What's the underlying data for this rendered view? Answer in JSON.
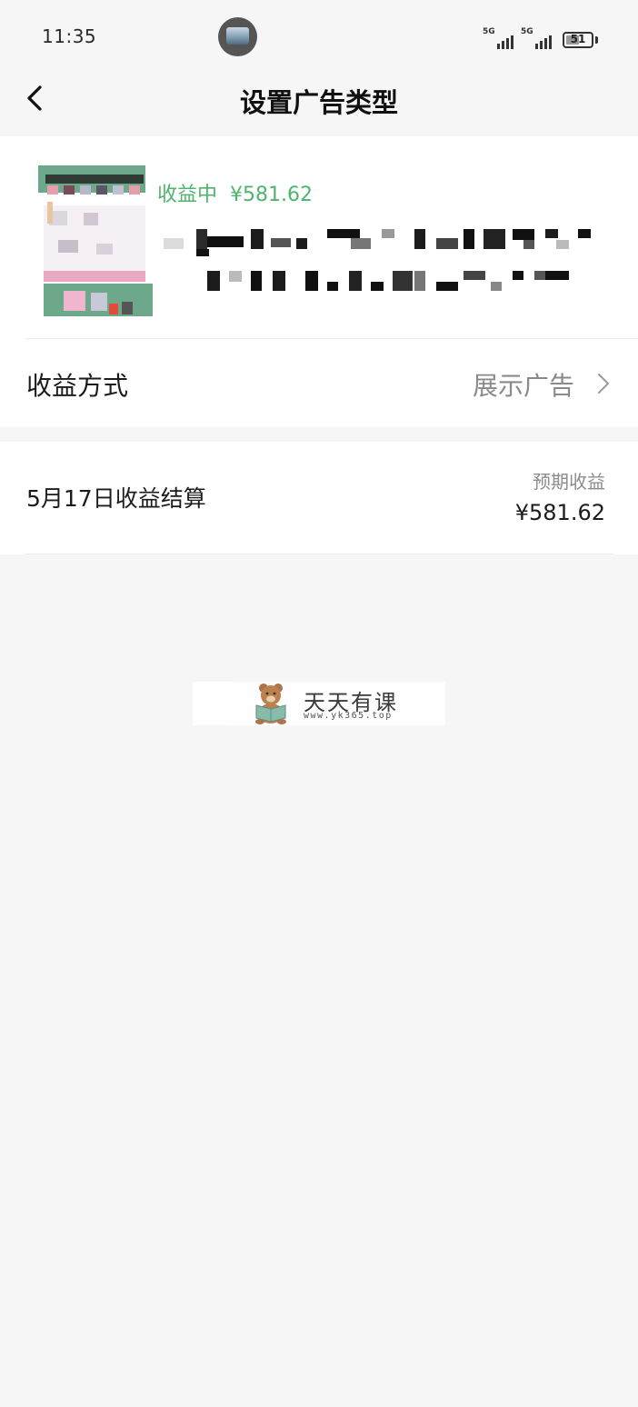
{
  "status_bar": {
    "time": "11:35",
    "signal_1": "5G",
    "signal_2": "5G",
    "battery_level": "51"
  },
  "nav": {
    "title": "设置广告类型"
  },
  "ad": {
    "status_label": "收益中",
    "amount": "¥581.62"
  },
  "revenue_method": {
    "label": "收益方式",
    "value": "展示广告"
  },
  "settlement": {
    "label": "5月17日收益结算",
    "expected_label": "预期收益",
    "amount": "¥581.62"
  },
  "watermark": {
    "title": "天天有课",
    "url": "www.yk365.top"
  },
  "colors": {
    "accent_green": "#4fb46c",
    "background": "#f6f6f6",
    "card": "#ffffff"
  }
}
